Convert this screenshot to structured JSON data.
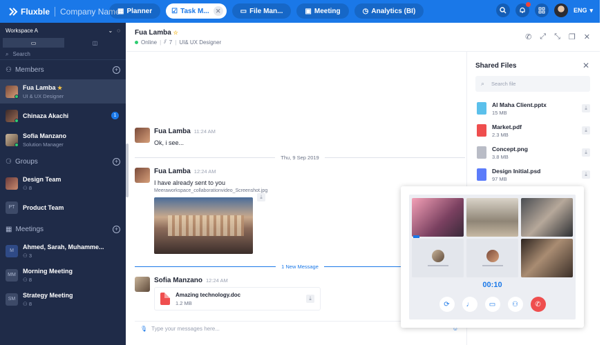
{
  "app": {
    "name": "Fluxble",
    "company": "Company Name"
  },
  "nav": {
    "tabs": [
      {
        "label": "Planner",
        "icon": "calendar-icon"
      },
      {
        "label": "Task M...",
        "icon": "task-icon"
      },
      {
        "label": "File Man...",
        "icon": "folder-icon"
      },
      {
        "label": "Meeting",
        "icon": "video-icon"
      },
      {
        "label": "Analytics (BI)",
        "icon": "analytics-icon"
      }
    ],
    "active_tab": "Task M...",
    "language": "ENG",
    "notifications_badge": "1"
  },
  "sidebar": {
    "workspace": "Workspace A",
    "search_placeholder": "Search",
    "members_label": "Members",
    "groups_label": "Groups",
    "meetings_label": "Meetings",
    "members": [
      {
        "name": "Fua Lamba",
        "sub": "UI & UX Designer",
        "active": true,
        "online": true
      },
      {
        "name": "Chinaza Akachi",
        "sub": "",
        "badge": "1",
        "online": true
      },
      {
        "name": "Sofia Manzano",
        "sub": "Solution Manager",
        "online": true
      }
    ],
    "groups": [
      {
        "name": "Design Team",
        "sub": "8"
      },
      {
        "name": "Product Team",
        "initials": "PT",
        "sub": ""
      }
    ],
    "meetings": [
      {
        "name": "Ahmed, Sarah, Muhamme...",
        "initials": "M",
        "sub": "3"
      },
      {
        "name": "Morning Meeting",
        "initials": "MM",
        "sub": "8"
      },
      {
        "name": "Strategy Meeting",
        "initials": "SM",
        "sub": "8"
      }
    ]
  },
  "chat": {
    "contact_name": "Fua Lamba",
    "status": "Online",
    "member_count": "7",
    "role": "UI& UX Designer",
    "messages": [
      {
        "author": "Fua Lamba",
        "time": "11:24 AM",
        "text": "Ok, i see..."
      },
      {
        "author": "Fua Lamba",
        "time": "12:24 AM",
        "text": "I have already sent to you",
        "attachment": "Meeraworkspace_collaborationvideo_Screenshot.jpg"
      },
      {
        "author": "Sofia Manzano",
        "time": "12:24 AM",
        "file_name": "Amazing technology.doc",
        "file_size": "1.2 MB"
      }
    ],
    "date_divider": "Thu, 9 Sep 2019",
    "new_divider": "1 New Message",
    "composer_placeholder": "Type your messages here..."
  },
  "shared_files": {
    "title": "Shared Files",
    "search_placeholder": "Search file",
    "files": [
      {
        "name": "Al Maha Client.pptx",
        "size": "15 MB",
        "color": "#5bc0eb"
      },
      {
        "name": "Market.pdf",
        "size": "2.3 MB",
        "color": "#ef4e4e"
      },
      {
        "name": "Concept.png",
        "size": "3.8 MB",
        "color": "#b9bcc6"
      },
      {
        "name": "Design Initial.psd",
        "size": "97 MB",
        "color": "#5c7cfa"
      }
    ]
  },
  "call": {
    "timer": "00:10",
    "controls": [
      "switch-camera-icon",
      "microphone-icon",
      "camera-icon",
      "add-participant-icon",
      "end-call-icon"
    ],
    "end_color": "#ef4e4e"
  },
  "colors": {
    "accent": "#1a78e8",
    "sidebar": "#1f2b48",
    "online": "#2ecc71"
  }
}
